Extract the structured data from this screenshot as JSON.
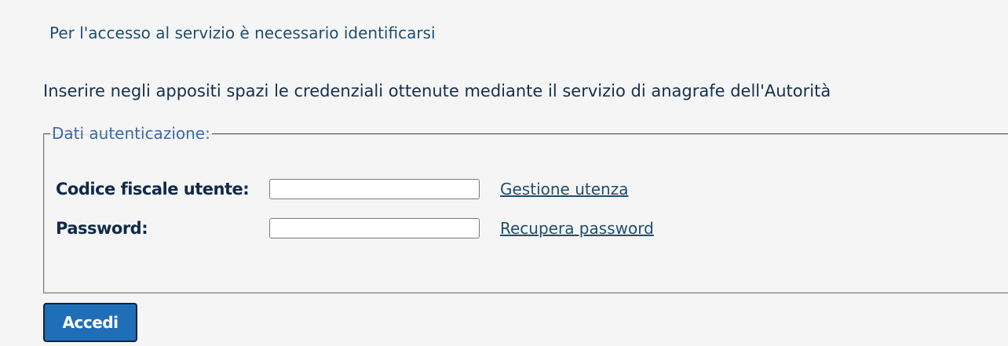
{
  "intro_text": "Per l'accesso al servizio è necessario identificarsi",
  "instructions": "Inserire negli appositi spazi le credenziali ottenute mediante il servizio di anagrafe dell'Autorità",
  "auth_fieldset": {
    "legend": "Dati autenticazione:",
    "fields": {
      "fiscal_code": {
        "label": "Codice fiscale utente:",
        "value": "",
        "placeholder": ""
      },
      "password": {
        "label": "Password:",
        "value": "",
        "placeholder": ""
      }
    },
    "links": {
      "manage_account": "Gestione utenza",
      "recover_password": "Recupera password"
    }
  },
  "submit_button_label": "Accedi",
  "colors": {
    "background": "#f5f5f5",
    "text": "#1f4e6e",
    "legend": "#3b6aa8",
    "button": "#1f6fb8"
  }
}
